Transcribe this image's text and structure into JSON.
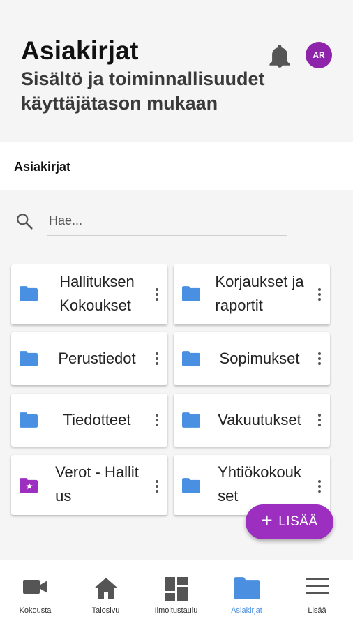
{
  "header": {
    "title": "Asiakirjat",
    "subtitle": "Sisältö ja toiminnallisuudet käyttäjätason mukaan",
    "avatar_initials": "AR",
    "avatar_color": "#8e24aa"
  },
  "breadcrumb": {
    "label": "Asiakirjat"
  },
  "search": {
    "placeholder": "Hae...",
    "value": ""
  },
  "folders": [
    {
      "line1": "Hallituksen",
      "line2": "Kokoukset",
      "icon": "folder-icon",
      "color": "#4a90e2"
    },
    {
      "line1": "Korjaukset ja",
      "line2": "raportit",
      "icon": "folder-icon",
      "color": "#4a90e2"
    },
    {
      "line1": "Perustiedot",
      "line2": "",
      "icon": "folder-icon",
      "color": "#4a90e2"
    },
    {
      "line1": "Sopimukset",
      "line2": "",
      "icon": "folder-icon",
      "color": "#4a90e2"
    },
    {
      "line1": "Tiedotteet",
      "line2": "",
      "icon": "folder-icon",
      "color": "#4a90e2"
    },
    {
      "line1": "Vakuutukset",
      "line2": "",
      "icon": "folder-icon",
      "color": "#4a90e2"
    },
    {
      "line1": "Verot - Hallit",
      "line2": "us",
      "icon": "starred-folder-icon",
      "color": "#9c2fbf"
    },
    {
      "line1": "Yhtiökokouk",
      "line2": "set",
      "icon": "folder-icon",
      "color": "#4a90e2"
    }
  ],
  "fab": {
    "label": "LISÄÄ",
    "color": "#9c2fbf"
  },
  "nav": [
    {
      "label": "Kokousta",
      "icon": "video-camera-icon",
      "active": false
    },
    {
      "label": "Talosivu",
      "icon": "home-icon",
      "active": false
    },
    {
      "label": "Ilmoitustaulu",
      "icon": "dashboard-icon",
      "active": false
    },
    {
      "label": "Asiakirjat",
      "icon": "folder-icon",
      "active": true
    },
    {
      "label": "Lisää",
      "icon": "menu-icon",
      "active": false
    }
  ],
  "colors": {
    "accent": "#4a8fe0",
    "purple": "#9c2fbf"
  }
}
